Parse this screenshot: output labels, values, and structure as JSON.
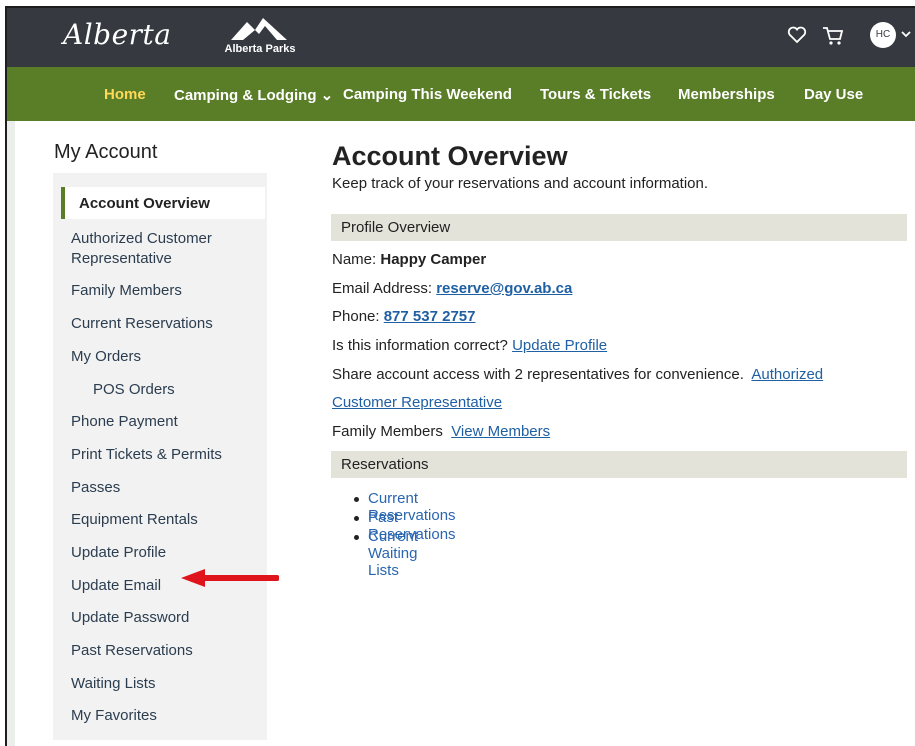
{
  "header": {
    "brand_script": "Alberta",
    "parks_label": "Alberta Parks",
    "favorites_icon": "heart-icon",
    "cart_icon": "cart-icon",
    "avatar_initials": "HC",
    "colors": {
      "topbar": "#363a40",
      "navbar": "#5a7d28",
      "active_nav": "#ffd957"
    }
  },
  "nav": {
    "items": [
      {
        "label": "Home",
        "active": true
      },
      {
        "label": "Camping & Lodging ⌄"
      },
      {
        "label": "Camping This Weekend"
      },
      {
        "label": "Tours & Tickets"
      },
      {
        "label": "Memberships"
      },
      {
        "label": "Day Use"
      }
    ]
  },
  "sidebar": {
    "title": "My Account",
    "active": "Account Overview",
    "items": [
      "Authorized Customer Representative",
      "Family Members",
      "Current Reservations",
      "My Orders",
      "POS Orders",
      "Phone Payment",
      "Print Tickets & Permits",
      "Passes",
      "Equipment Rentals",
      "Update Profile",
      "Update Email",
      "Update Password",
      "Past Reservations",
      "Waiting Lists",
      "My Favorites"
    ]
  },
  "main": {
    "title": "Account Overview",
    "subtitle": "Keep track of your reservations and account information.",
    "profile": {
      "header": "Profile Overview",
      "name_label": "Name:",
      "name_value": "Happy Camper",
      "email_label": "Email Address:",
      "email_value": "reserve@gov.ab.ca",
      "phone_label": "Phone:",
      "phone_value": "877 537 2757",
      "correct_q": "Is this information correct?",
      "update_profile_link": "Update Profile",
      "share_text": "Share account access with 2 representatives for convenience.",
      "acr_link_1": "Authorized",
      "acr_link_2": "Customer Representative",
      "family_label": "Family Members",
      "view_members_link": "View Members"
    },
    "reservations": {
      "header": "Reservations",
      "links": [
        "Current Reservations",
        "Past Reservations",
        "Current Waiting Lists"
      ]
    }
  },
  "annotation": {
    "arrow_color": "#e0141c",
    "points_to": "Update Email"
  }
}
